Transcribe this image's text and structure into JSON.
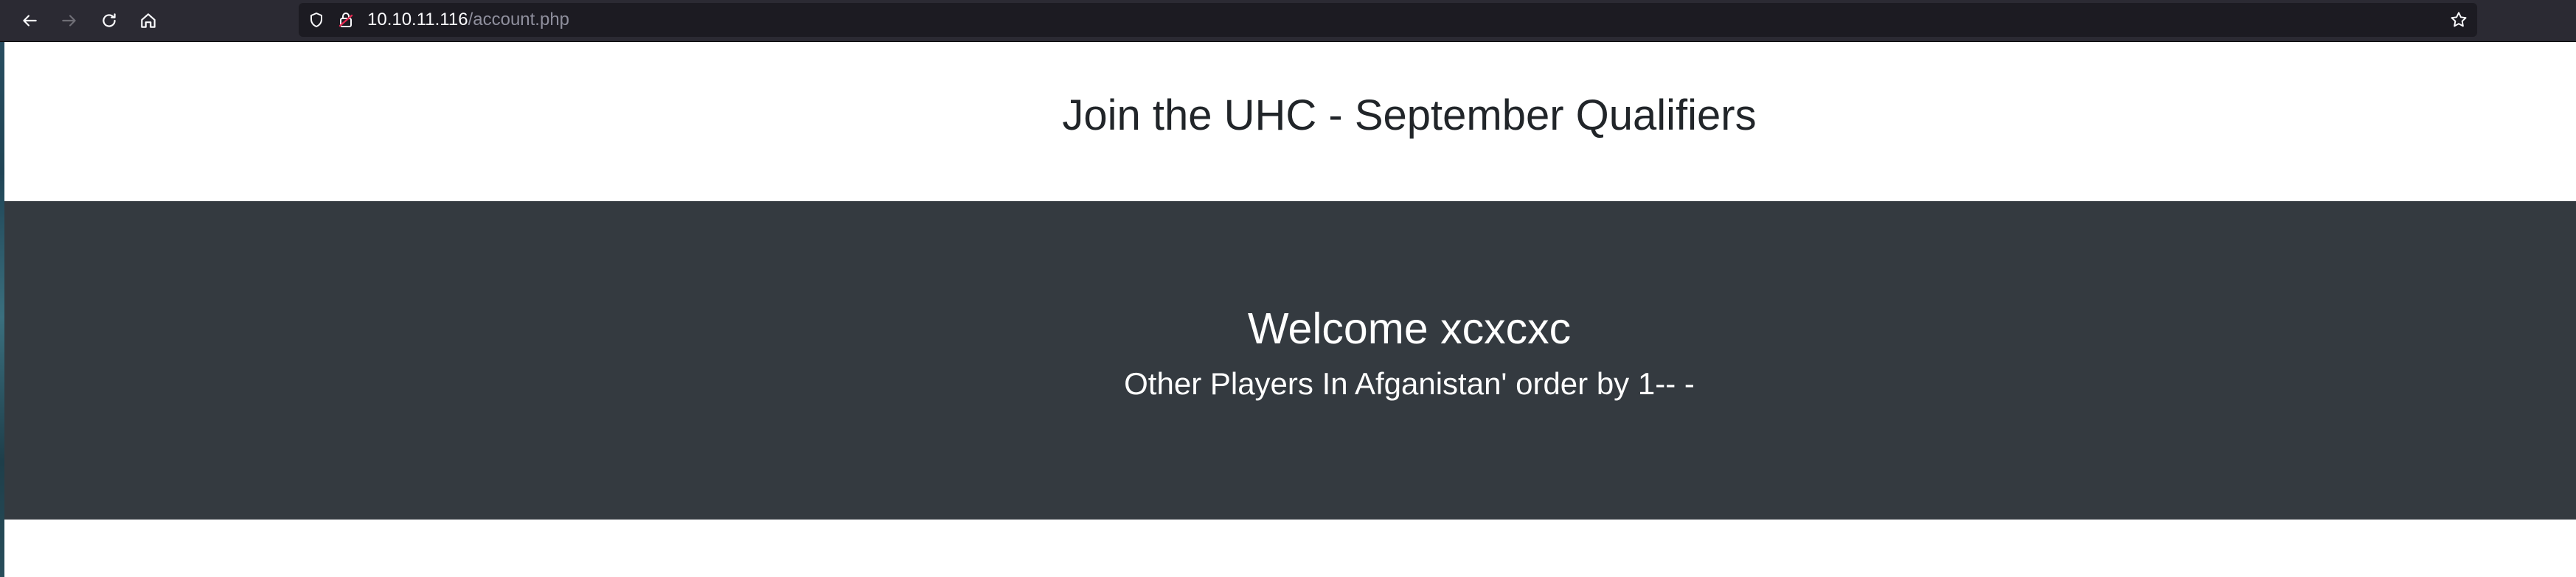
{
  "browser": {
    "url_host": "10.10.11.116",
    "url_path": "/account.php",
    "icons": [
      "back-arrow-icon",
      "forward-arrow-icon",
      "reload-icon",
      "home-icon",
      "shield-icon",
      "lock-icon",
      "star-icon"
    ]
  },
  "page": {
    "title": "Join the UHC - September Qualifiers",
    "welcome": "Welcome xcxcxc",
    "players_line": "Other Players In Afganistan' order by 1-- -"
  },
  "colors": {
    "toolbar": "#2b2a33",
    "urlbar": "#1c1b22",
    "hero": "#343a40",
    "page_bg": "#ffffff",
    "title_text": "#212529"
  }
}
